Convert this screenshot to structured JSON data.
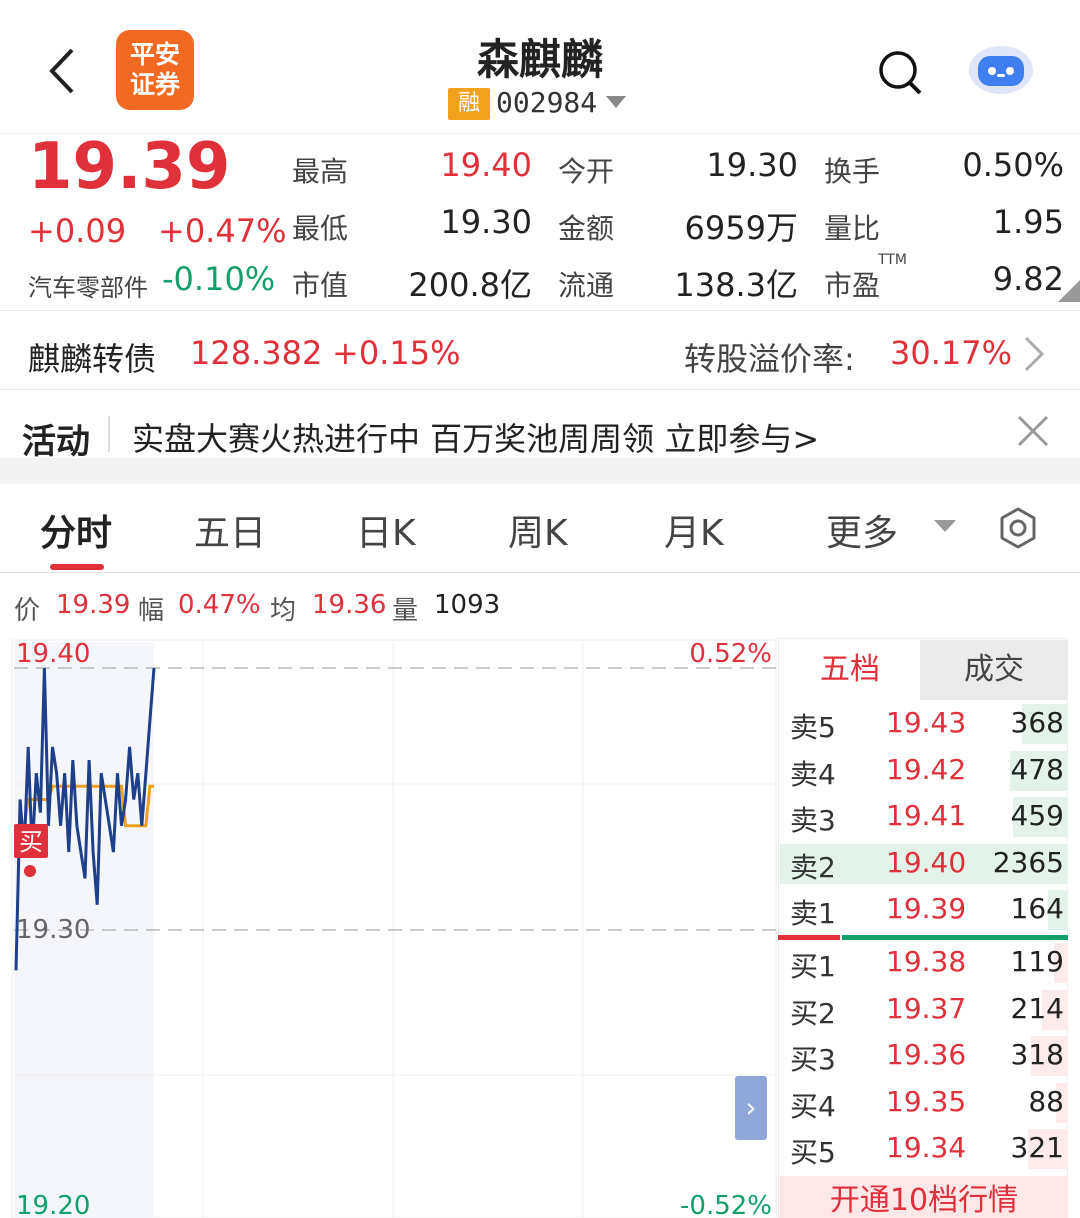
{
  "header": {
    "logo_text": "平安证券",
    "stock_name": "森麒麟",
    "margin_badge": "融",
    "stock_code": "002984"
  },
  "quote": {
    "price": "19.39",
    "change": "+0.09",
    "change_pct": "+0.47%",
    "sector": "汽车零部件",
    "sector_pct": "-0.10%",
    "stats": [
      {
        "label": "最高",
        "value": "19.40"
      },
      {
        "label": "今开",
        "value": "19.30"
      },
      {
        "label": "换手",
        "value": "0.50%"
      },
      {
        "label": "最低",
        "value": "19.30"
      },
      {
        "label": "金额",
        "value": "6959万"
      },
      {
        "label": "量比",
        "value": "1.95"
      },
      {
        "label": "市值",
        "value": "200.8亿"
      },
      {
        "label": "流通",
        "value": "138.3亿"
      },
      {
        "label": "市盈",
        "value": "9.82"
      }
    ],
    "ttm": "TTM"
  },
  "bond": {
    "name": "麒麟转债",
    "price": "128.382",
    "change_pct": "+0.15%",
    "premium_label": "转股溢价率:",
    "premium_value": "30.17%"
  },
  "activity": {
    "tag": "活动",
    "text": "实盘大赛火热进行中 百万奖池周周领 立即参与>"
  },
  "tabs": [
    "分时",
    "五日",
    "日K",
    "周K",
    "月K",
    "更多"
  ],
  "info": {
    "price_label": "价",
    "price": "19.39",
    "amp_label": "幅",
    "amp": "0.47%",
    "avg_label": "均",
    "avg": "19.36",
    "vol_label": "量",
    "vol": "1093"
  },
  "chart_data": {
    "type": "line",
    "y_high": "19.40",
    "y_mid": "19.30",
    "y_low": "19.20",
    "pct_high": "0.52%",
    "pct_low": "-0.52%",
    "ylim": [
      19.2,
      19.4
    ],
    "series": [
      {
        "values": [
          19.285,
          19.35,
          19.33,
          19.37,
          19.33,
          19.36,
          19.345,
          19.4,
          19.34,
          19.37,
          19.36,
          19.34,
          19.36,
          19.33,
          19.365,
          19.34,
          19.33,
          19.32,
          19.365,
          19.33,
          19.31,
          19.36,
          19.35,
          19.34,
          19.33,
          19.36,
          19.34,
          19.35,
          19.37,
          19.35,
          19.36,
          19.34,
          19.36,
          19.38,
          19.4
        ]
      },
      {
        "values": [
          19.33,
          19.34,
          19.34,
          19.35,
          19.35,
          19.35,
          19.35,
          19.35,
          19.35,
          19.355,
          19.355,
          19.355,
          19.355,
          19.355,
          19.355,
          19.355,
          19.355,
          19.355,
          19.355,
          19.355,
          19.355,
          19.355,
          19.355,
          19.355,
          19.355,
          19.355,
          19.355,
          19.34,
          19.34,
          19.34,
          19.34,
          19.34,
          19.34,
          19.355,
          19.355
        ]
      }
    ],
    "marker_label": "买"
  },
  "orderbook": {
    "tab_active": "五档",
    "tab_inactive": "成交",
    "asks": [
      {
        "label": "卖5",
        "price": "19.43",
        "vol": "368",
        "bar": 0.16
      },
      {
        "label": "卖4",
        "price": "19.42",
        "vol": "478",
        "bar": 0.2
      },
      {
        "label": "卖3",
        "price": "19.41",
        "vol": "459",
        "bar": 0.19
      },
      {
        "label": "卖2",
        "price": "19.40",
        "vol": "2365",
        "bar": 1.0
      },
      {
        "label": "卖1",
        "price": "19.39",
        "vol": "164",
        "bar": 0.07
      }
    ],
    "bids": [
      {
        "label": "买1",
        "price": "19.38",
        "vol": "119",
        "bar": 0.05
      },
      {
        "label": "买2",
        "price": "19.37",
        "vol": "214",
        "bar": 0.09
      },
      {
        "label": "买3",
        "price": "19.36",
        "vol": "318",
        "bar": 0.13
      },
      {
        "label": "买4",
        "price": "19.35",
        "vol": "88",
        "bar": 0.04
      },
      {
        "label": "买5",
        "price": "19.34",
        "vol": "321",
        "bar": 0.14
      }
    ],
    "bottom_button": "开通10档行情"
  },
  "colors": {
    "up": "#e0303a",
    "down": "#12a06a",
    "price_line": "#1f3f8a",
    "avg_line": "#f0a020"
  }
}
